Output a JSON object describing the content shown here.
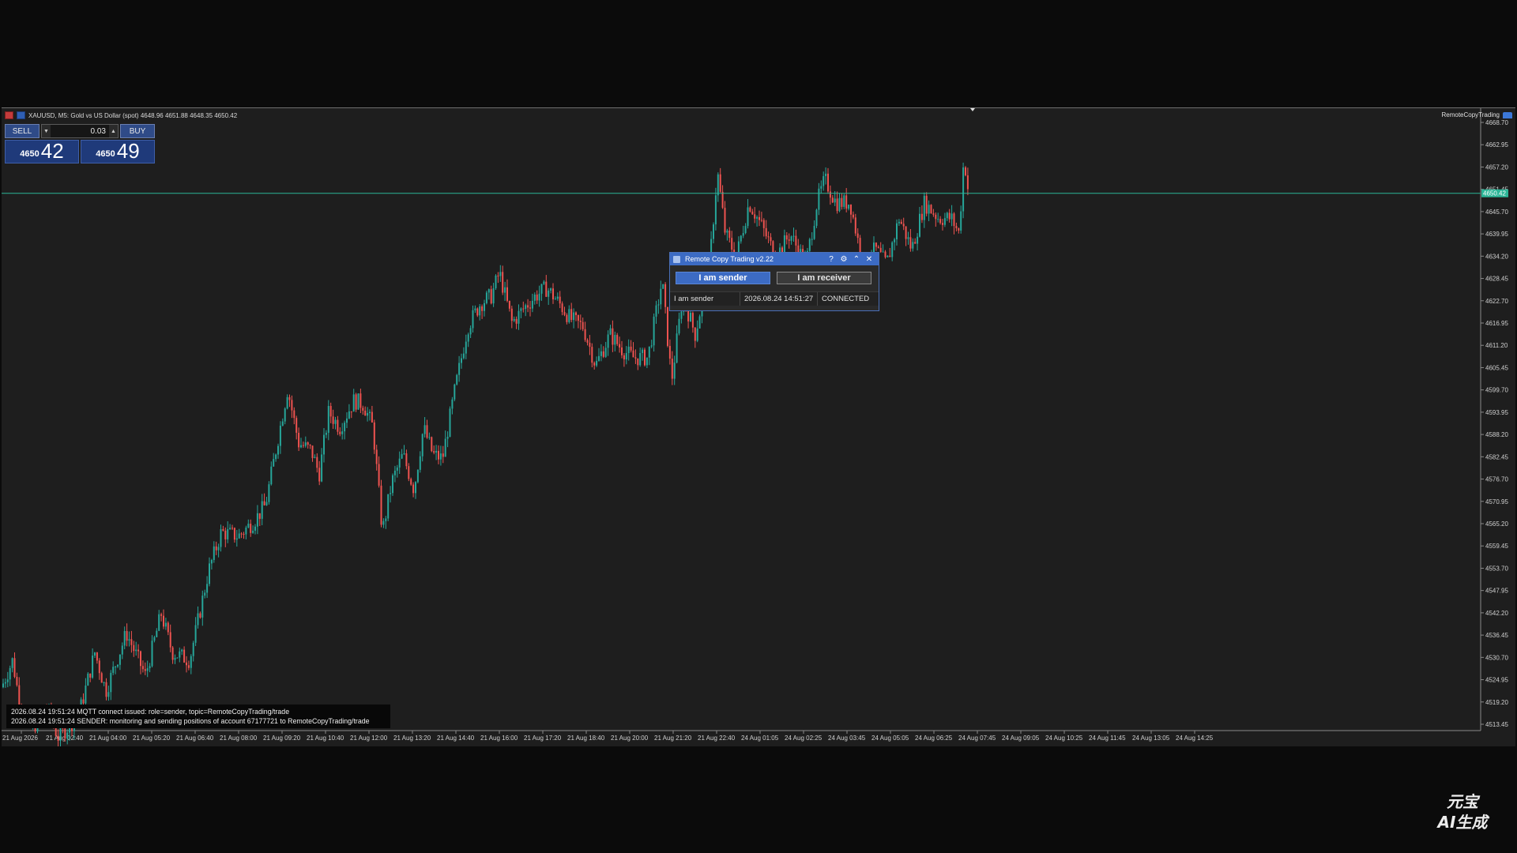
{
  "chart": {
    "header": "XAUUSD, M5:  Gold vs US Dollar (spot)  4648.96 4651.88 4648.35 4650.42",
    "ea_name": "RemoteCopyTrading",
    "current_price": "4650.42",
    "y_axis": {
      "labels": [
        "4668.70",
        "4662.95",
        "4657.20",
        "4651.45",
        "4645.70",
        "4639.95",
        "4634.20",
        "4628.45",
        "4622.70",
        "4616.95",
        "4611.20",
        "4605.45",
        "4599.70",
        "4593.95",
        "4588.20",
        "4582.45",
        "4576.70",
        "4570.95",
        "4565.20",
        "4559.45",
        "4553.70",
        "4547.95",
        "4542.20",
        "4536.45",
        "4530.70",
        "4524.95",
        "4519.20",
        "4513.45"
      ],
      "min": 4513.45,
      "max": 4668.7
    },
    "x_axis": {
      "labels": [
        "21 Aug 2026",
        "21 Aug 02:40",
        "21 Aug 04:00",
        "21 Aug 05:20",
        "21 Aug 06:40",
        "21 Aug 08:00",
        "21 Aug 09:20",
        "21 Aug 10:40",
        "21 Aug 12:00",
        "21 Aug 13:20",
        "21 Aug 14:40",
        "21 Aug 16:00",
        "21 Aug 17:20",
        "21 Aug 18:40",
        "21 Aug 20:00",
        "21 Aug 21:20",
        "21 Aug 22:40",
        "24 Aug 01:05",
        "24 Aug 02:25",
        "24 Aug 03:45",
        "24 Aug 05:05",
        "24 Aug 06:25",
        "24 Aug 07:45",
        "24 Aug 09:05",
        "24 Aug 10:25",
        "24 Aug 11:45",
        "24 Aug 13:05",
        "24 Aug 14:25"
      ]
    },
    "colors": {
      "bull": "#26a69a",
      "bear": "#ef5350",
      "bid_line": "#2bb597",
      "background": "#1e1e1e"
    },
    "price_path": [
      [
        0,
        4523
      ],
      [
        14,
        4530
      ],
      [
        22,
        4520
      ],
      [
        38,
        4512
      ],
      [
        56,
        4518
      ],
      [
        72,
        4510
      ],
      [
        98,
        4516
      ],
      [
        118,
        4532
      ],
      [
        132,
        4522
      ],
      [
        158,
        4537
      ],
      [
        182,
        4526
      ],
      [
        202,
        4542
      ],
      [
        216,
        4532
      ],
      [
        238,
        4530
      ],
      [
        262,
        4553
      ],
      [
        278,
        4563
      ],
      [
        300,
        4562
      ],
      [
        320,
        4566
      ],
      [
        334,
        4570
      ],
      [
        346,
        4583
      ],
      [
        362,
        4600
      ],
      [
        376,
        4586
      ],
      [
        392,
        4584
      ],
      [
        402,
        4578
      ],
      [
        414,
        4594
      ],
      [
        428,
        4590
      ],
      [
        446,
        4597
      ],
      [
        458,
        4596
      ],
      [
        470,
        4590
      ],
      [
        482,
        4563
      ],
      [
        494,
        4576
      ],
      [
        508,
        4583
      ],
      [
        522,
        4574
      ],
      [
        534,
        4590
      ],
      [
        546,
        4583
      ],
      [
        558,
        4582
      ],
      [
        574,
        4600
      ],
      [
        590,
        4616
      ],
      [
        606,
        4622
      ],
      [
        620,
        4624
      ],
      [
        630,
        4630
      ],
      [
        646,
        4617
      ],
      [
        662,
        4621
      ],
      [
        676,
        4624
      ],
      [
        690,
        4626
      ],
      [
        706,
        4622
      ],
      [
        720,
        4618
      ],
      [
        736,
        4616
      ],
      [
        752,
        4606
      ],
      [
        770,
        4614
      ],
      [
        786,
        4610
      ],
      [
        800,
        4608
      ],
      [
        818,
        4608
      ],
      [
        836,
        4628
      ],
      [
        848,
        4602
      ],
      [
        862,
        4624
      ],
      [
        878,
        4614
      ],
      [
        896,
        4632
      ],
      [
        906,
        4656
      ],
      [
        916,
        4640
      ],
      [
        930,
        4634
      ],
      [
        946,
        4648
      ],
      [
        962,
        4642
      ],
      [
        980,
        4634
      ],
      [
        998,
        4640
      ],
      [
        1018,
        4632
      ],
      [
        1032,
        4648
      ],
      [
        1042,
        4654
      ],
      [
        1056,
        4648
      ],
      [
        1074,
        4648
      ],
      [
        1090,
        4632
      ],
      [
        1106,
        4636
      ],
      [
        1120,
        4632
      ],
      [
        1136,
        4644
      ],
      [
        1152,
        4636
      ],
      [
        1168,
        4648
      ],
      [
        1186,
        4644
      ],
      [
        1202,
        4644
      ],
      [
        1212,
        4640
      ],
      [
        1218,
        4660
      ],
      [
        1224,
        4650
      ]
    ]
  },
  "trade_panel": {
    "sell_label": "SELL",
    "buy_label": "BUY",
    "lot": "0.03",
    "bid_prefix": "4650",
    "bid_big": "42",
    "ask_prefix": "4650",
    "ask_big": "49"
  },
  "dialog": {
    "title": "Remote Copy Trading v2.22",
    "help": "?",
    "sender_label": "I am sender",
    "receiver_label": "I am receiver",
    "status_role": "I am sender",
    "status_time": "2026.08.24 14:51:27",
    "status_state": "CONNECTED"
  },
  "log": {
    "line1": "2026.08.24 19:51:24 MQTT connect issued: role=sender, topic=RemoteCopyTrading/trade",
    "line2": "2026.08.24 19:51:24 SENDER: monitoring and sending positions of account 67177721 to RemoteCopyTrading/trade"
  },
  "watermark": {
    "line1": "元宝",
    "line2": "AI生成"
  }
}
